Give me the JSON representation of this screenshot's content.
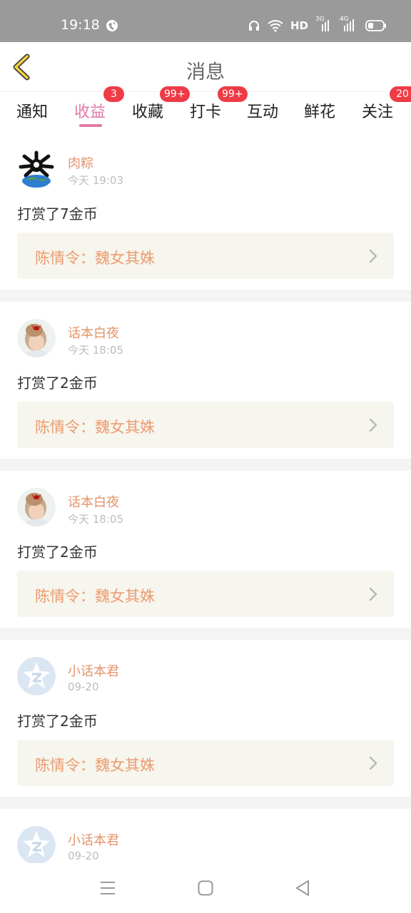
{
  "status_bar": {
    "time": "19:18",
    "network_label": "HD",
    "net1": "3G",
    "net2": "4G",
    "icons": [
      "globe-icon",
      "headphones-icon",
      "wifi-icon",
      "signal-icon",
      "battery-icon"
    ]
  },
  "header": {
    "title": "消息",
    "back_icon": "chevron-left-icon"
  },
  "tabs": [
    {
      "label": "通知",
      "badge": ""
    },
    {
      "label": "收益",
      "badge": "3",
      "active": true
    },
    {
      "label": "收藏",
      "badge": "99+"
    },
    {
      "label": "打卡",
      "badge": "99+"
    },
    {
      "label": "互动",
      "badge": ""
    },
    {
      "label": "鲜花",
      "badge": ""
    },
    {
      "label": "关注",
      "badge": "20"
    }
  ],
  "messages": [
    {
      "user": "肉粽",
      "time": "今天 19:03",
      "action": "打赏了7金币",
      "book": "陈情令：魏女其姝"
    },
    {
      "user": "话本白夜",
      "time": "今天 18:05",
      "action": "打赏了2金币",
      "book": "陈情令：魏女其姝"
    },
    {
      "user": "话本白夜",
      "time": "今天 18:05",
      "action": "打赏了2金币",
      "book": "陈情令：魏女其姝"
    },
    {
      "user": "小话本君",
      "time": "09-20",
      "action": "打赏了2金币",
      "book": "陈情令：魏女其姝"
    },
    {
      "user": "小话本君",
      "time": "09-20"
    }
  ],
  "colors": {
    "accent": "#e27aa9",
    "badge": "#ee3b46",
    "username": "#e4946a",
    "book_bg": "#f6f5ee",
    "book_text": "#ec9c6e"
  },
  "nav_bar": {
    "icons": [
      "menu-icon",
      "home-square-icon",
      "back-triangle-icon"
    ]
  }
}
